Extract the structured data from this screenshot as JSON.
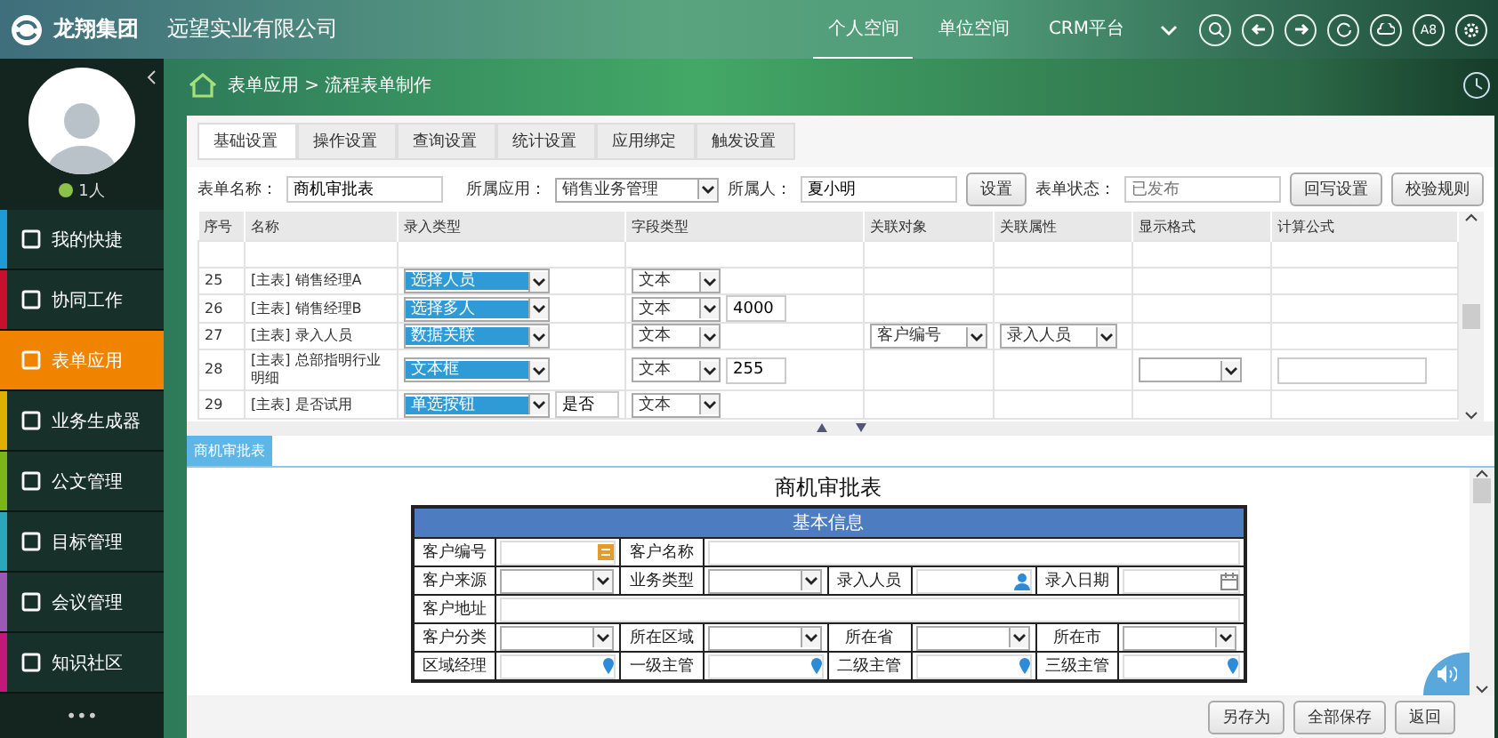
{
  "header": {
    "brand": "龙翔集团",
    "company": "远望实业有限公司",
    "nav": [
      {
        "label": "个人空间",
        "selected": true
      },
      {
        "label": "单位空间",
        "selected": false
      },
      {
        "label": "CRM平台",
        "selected": false
      }
    ],
    "badge_icon_text": "A8"
  },
  "sidebar": {
    "online": true,
    "user_count": "1人",
    "items": [
      {
        "label": "我的快捷",
        "selected": false,
        "color": "#1e9bd7"
      },
      {
        "label": "协同工作",
        "selected": false,
        "color": "#c8102e"
      },
      {
        "label": "表单应用",
        "selected": true,
        "color": "#f08300"
      },
      {
        "label": "业务生成器",
        "selected": false,
        "color": "#e0b000"
      },
      {
        "label": "公文管理",
        "selected": false,
        "color": "#7cb518"
      },
      {
        "label": "目标管理",
        "selected": false,
        "color": "#2aa7b8"
      },
      {
        "label": "会议管理",
        "selected": false,
        "color": "#9b59b6"
      },
      {
        "label": "知识社区",
        "selected": false,
        "color": "#c2187a"
      }
    ],
    "more": "•••"
  },
  "breadcrumb": "表单应用 > 流程表单制作",
  "tabs": [
    {
      "label": "基础设置",
      "selected": true
    },
    {
      "label": "操作设置",
      "selected": false
    },
    {
      "label": "查询设置",
      "selected": false
    },
    {
      "label": "统计设置",
      "selected": false
    },
    {
      "label": "应用绑定",
      "selected": false
    },
    {
      "label": "触发设置",
      "selected": false
    }
  ],
  "form_bar": {
    "name_label": "表单名称：",
    "name_value": "商机审批表",
    "app_label": "所属应用：",
    "app_value": "销售业务管理",
    "owner_label": "所属人：",
    "owner_value": "夏小明",
    "set_button": "设置",
    "status_label": "表单状态：",
    "status_placeholder": "已发布",
    "buttons": [
      "回写设置",
      "校验规则"
    ]
  },
  "table": {
    "columns": [
      "序号",
      "名称",
      "录入类型",
      "字段类型",
      "关联对象",
      "关联属性",
      "显示格式",
      "计算公式"
    ],
    "rows": [
      {
        "seq": "25",
        "name": "[主表] 销售经理A",
        "input_type": "选择人员",
        "field_type": "文本"
      },
      {
        "seq": "26",
        "name": "[主表] 销售经理B",
        "input_type": "选择多人",
        "field_type": "文本",
        "field_length": "4000"
      },
      {
        "seq": "27",
        "name": "[主表] 录入人员",
        "input_type": "数据关联",
        "field_type": "文本",
        "link_object": "客户编号",
        "link_attr": "录入人员"
      },
      {
        "seq": "28",
        "name": "[主表] 总部指明行业明细",
        "input_type": "文本框",
        "field_type": "文本",
        "field_length": "255",
        "format_select": true,
        "formula_field": true
      },
      {
        "seq": "29",
        "name": "[主表] 是否试用",
        "input_type": "单选按钮",
        "input_extra": "是否",
        "field_type": "文本"
      }
    ]
  },
  "preview": {
    "tab": {
      "label": "商机审批表",
      "selected": true
    },
    "title": "商机审批表",
    "section": "基本信息",
    "rows": [
      [
        {
          "kind": "label",
          "text": "客户编号"
        },
        {
          "kind": "code"
        },
        {
          "kind": "label",
          "text": "客户名称"
        },
        {
          "kind": "input"
        }
      ],
      [
        {
          "kind": "label",
          "text": "客户来源"
        },
        {
          "kind": "select"
        },
        {
          "kind": "label",
          "text": "业务类型"
        },
        {
          "kind": "select"
        },
        {
          "kind": "label",
          "text": "录入人员"
        },
        {
          "kind": "person"
        },
        {
          "kind": "label",
          "text": "录入日期"
        },
        {
          "kind": "date"
        }
      ],
      [
        {
          "kind": "label",
          "text": "客户地址"
        },
        {
          "kind": "input"
        }
      ],
      [
        {
          "kind": "label",
          "text": "客户分类"
        },
        {
          "kind": "select"
        },
        {
          "kind": "label",
          "text": "所在区域"
        },
        {
          "kind": "select"
        },
        {
          "kind": "label",
          "text": "所在省"
        },
        {
          "kind": "select"
        },
        {
          "kind": "label",
          "text": "所在市"
        },
        {
          "kind": "select"
        }
      ],
      [
        {
          "kind": "label",
          "text": "区域经理"
        },
        {
          "kind": "locate"
        },
        {
          "kind": "label",
          "text": "一级主管"
        },
        {
          "kind": "locate"
        },
        {
          "kind": "label",
          "text": "二级主管"
        },
        {
          "kind": "locate"
        },
        {
          "kind": "label",
          "text": "三级主管"
        },
        {
          "kind": "locate"
        }
      ]
    ]
  },
  "footer_buttons": [
    "另存为",
    "全部保存",
    "返回"
  ]
}
